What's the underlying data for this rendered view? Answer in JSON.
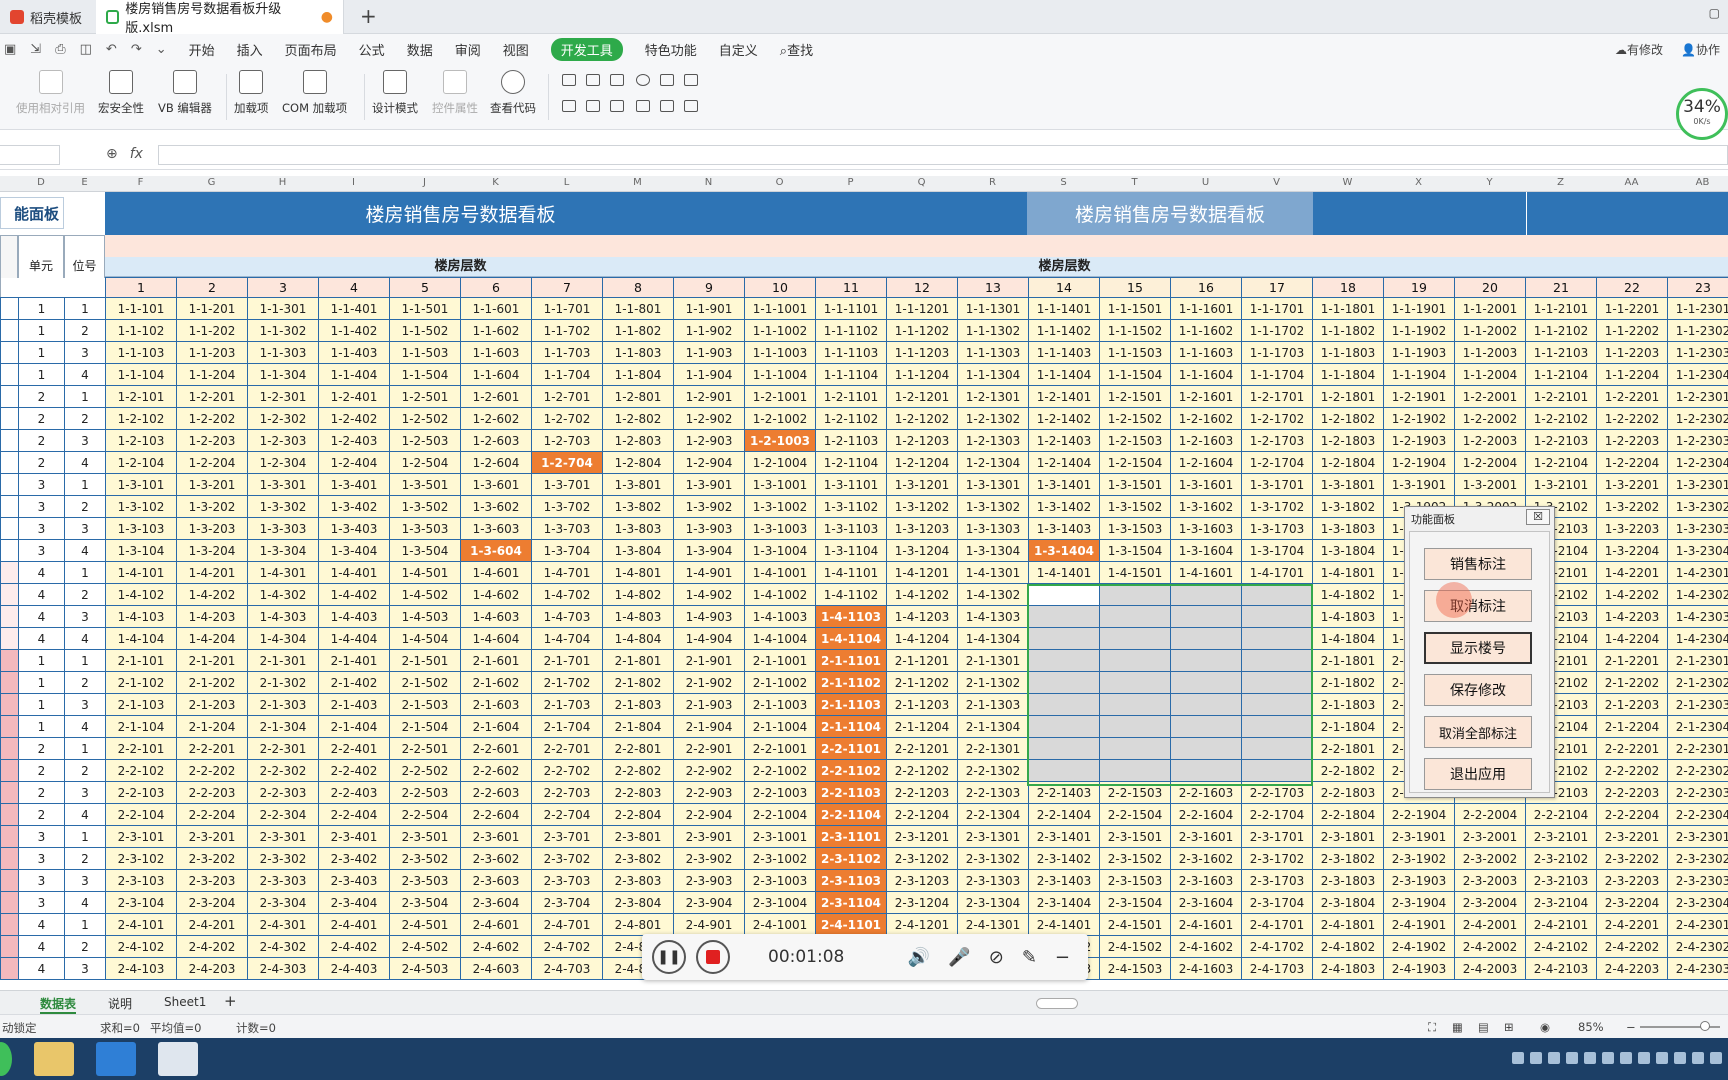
{
  "tabs": {
    "tab1": "稻壳模板",
    "tab2": "楼房销售房号数据看板升级版.xlsm"
  },
  "menu": {
    "items": [
      "开始",
      "插入",
      "页面布局",
      "公式",
      "数据",
      "审阅",
      "视图",
      "开发工具",
      "特色功能",
      "自定义"
    ],
    "search": "查找",
    "right": [
      "有修改",
      "协作"
    ]
  },
  "ribbon": {
    "items": [
      "使用相对引用",
      "宏安全性",
      "VB 编辑器",
      "加载项",
      "COM 加载项",
      "设计模式",
      "控件属性",
      "查看代码"
    ]
  },
  "speed": {
    "pct": "34%",
    "rate": "0K/s"
  },
  "formula": {
    "fx": "fx"
  },
  "columns": [
    "D",
    "E",
    "F",
    "G",
    "H",
    "I",
    "J",
    "K",
    "L",
    "M",
    "N",
    "O",
    "P",
    "Q",
    "R",
    "S",
    "T",
    "U",
    "V",
    "W",
    "X",
    "Y",
    "Z",
    "AA",
    "AB"
  ],
  "sheet": {
    "title_left": "楼房销售房号数据看板",
    "title_right": "楼房销售房号数据看板",
    "panel_label": "能面板",
    "floor_label": "楼房层数",
    "unit_label": "单元",
    "pos_label": "位号",
    "floors": [
      "1",
      "2",
      "3",
      "4",
      "5",
      "6",
      "7",
      "8",
      "9",
      "10",
      "11",
      "12",
      "13",
      "14",
      "15",
      "16",
      "17",
      "18",
      "19",
      "20",
      "21",
      "22",
      "23"
    ]
  },
  "dialog": {
    "title": "功能面板",
    "close": "☒",
    "buttons": [
      "销售标注",
      "取消标注",
      "显示楼号",
      "保存修改",
      "取消全部标注",
      "退出应用"
    ]
  },
  "recorder": {
    "time": "00:01:08"
  },
  "sheettabs": [
    "数据表",
    "说明",
    "Sheet1"
  ],
  "status": {
    "left": "动锁定",
    "sum": "求和=0",
    "avg": "平均值=0",
    "count": "计数=0",
    "zoom": "85%"
  },
  "colors": {
    "accent": "#2e74b5",
    "highlight": "#ed7d31",
    "active": "#2eaa4a"
  }
}
